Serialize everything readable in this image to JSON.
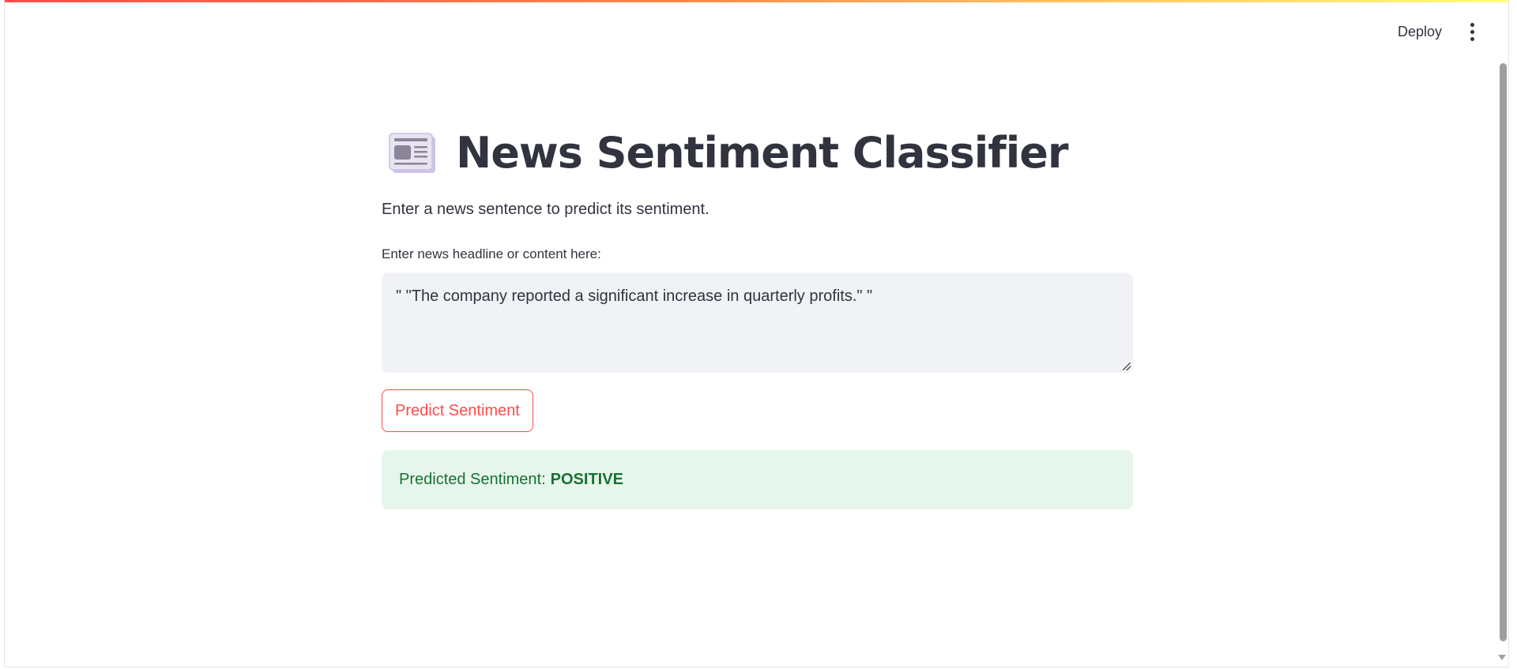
{
  "toolbar": {
    "deploy_label": "Deploy",
    "menu_icon": "more-vert-icon"
  },
  "page": {
    "title_icon": "newspaper-emoji-icon",
    "title": "News Sentiment Classifier",
    "subtitle": "Enter a news sentence to predict its sentiment."
  },
  "input": {
    "label": "Enter news headline or content here:",
    "value": "\" \"The company reported a significant increase in quarterly profits.\" \""
  },
  "actions": {
    "predict_label": "Predict Sentiment"
  },
  "result": {
    "prefix": "Predicted Sentiment:",
    "value": "POSITIVE"
  },
  "colors": {
    "primary": "#ff4b4b",
    "text": "#31333f",
    "input_bg": "#f0f2f6",
    "success_bg": "#e6f6ec",
    "success_text": "#177233"
  }
}
